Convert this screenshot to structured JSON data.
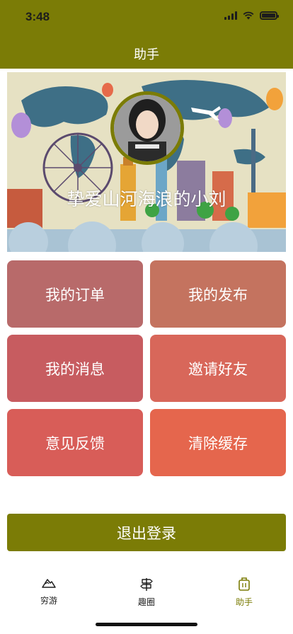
{
  "status": {
    "time": "3:48"
  },
  "nav": {
    "title": "助手"
  },
  "profile": {
    "username": "挚爱山河海浪的小刘"
  },
  "menu": [
    {
      "label": "我的订单",
      "color": "#b86a6a"
    },
    {
      "label": "我的发布",
      "color": "#c4735f"
    },
    {
      "label": "我的消息",
      "color": "#c75c60"
    },
    {
      "label": "邀请好友",
      "color": "#d8675a"
    },
    {
      "label": "意见反馈",
      "color": "#d85d58"
    },
    {
      "label": "清除缓存",
      "color": "#e5664d"
    }
  ],
  "logout": {
    "label": "退出登录"
  },
  "tabs": [
    {
      "label": "穷游",
      "icon": "mountain-icon",
      "active": false
    },
    {
      "label": "趣圈",
      "icon": "signpost-icon",
      "active": false
    },
    {
      "label": "助手",
      "icon": "luggage-icon",
      "active": true
    }
  ],
  "colors": {
    "brand": "#7b7c06"
  }
}
